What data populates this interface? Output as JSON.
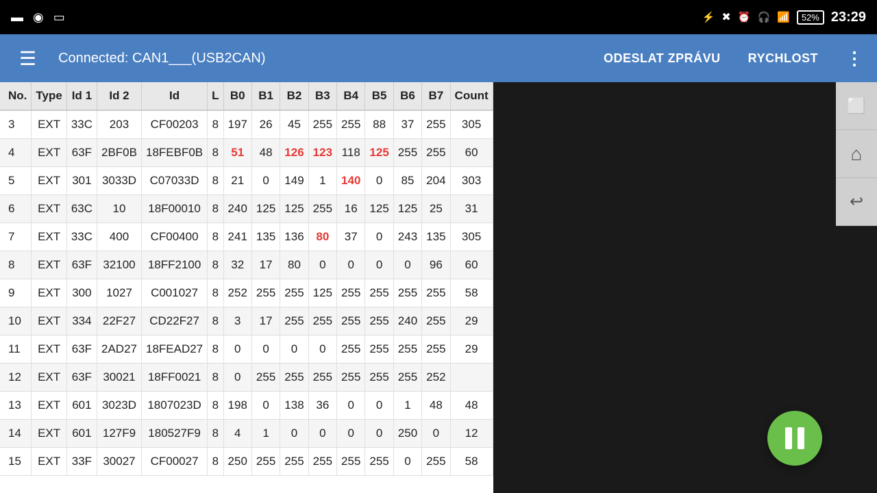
{
  "statusBar": {
    "time": "23:29",
    "battery": "52%",
    "icons": [
      "bluetooth",
      "muted",
      "alarm",
      "headset",
      "signal"
    ]
  },
  "appBar": {
    "title": "Connected: CAN1___(USB2CAN)",
    "action1": "ODESLAT ZPRÁVU",
    "action2": "RYCHLOST",
    "menuIcon": "⋮"
  },
  "table": {
    "headers": [
      "No.",
      "Type",
      "Id 1",
      "Id 2",
      "Id",
      "L",
      "B0",
      "B1",
      "B2",
      "B3",
      "B4",
      "B5",
      "B6",
      "B7",
      "Count"
    ],
    "rows": [
      {
        "no": "3",
        "type": "EXT",
        "id1": "33C",
        "id2": "203",
        "id": "CF00203",
        "l": "8",
        "b0": "197",
        "b1": "26",
        "b2": "45",
        "b3": "255",
        "b4": "255",
        "b5": "88",
        "b6": "37",
        "b7": "255",
        "count": "305",
        "highlights": []
      },
      {
        "no": "4",
        "type": "EXT",
        "id1": "63F",
        "id2": "2BF0B",
        "id": "18FEBF0B",
        "l": "8",
        "b0": "51",
        "b1": "48",
        "b2": "126",
        "b3": "123",
        "b4": "118",
        "b5": "125",
        "b6": "255",
        "b7": "255",
        "count": "60",
        "highlights": [
          "b0",
          "b2",
          "b3",
          "b5"
        ]
      },
      {
        "no": "5",
        "type": "EXT",
        "id1": "301",
        "id2": "3033D",
        "id": "C07033D",
        "l": "8",
        "b0": "21",
        "b1": "0",
        "b2": "149",
        "b3": "1",
        "b4": "140",
        "b5": "0",
        "b6": "85",
        "b7": "204",
        "count": "303",
        "highlights": [
          "b4"
        ]
      },
      {
        "no": "6",
        "type": "EXT",
        "id1": "63C",
        "id2": "10",
        "id": "18F00010",
        "l": "8",
        "b0": "240",
        "b1": "125",
        "b2": "125",
        "b3": "255",
        "b4": "16",
        "b5": "125",
        "b6": "125",
        "b7": "25",
        "count": "31",
        "highlights": []
      },
      {
        "no": "7",
        "type": "EXT",
        "id1": "33C",
        "id2": "400",
        "id": "CF00400",
        "l": "8",
        "b0": "241",
        "b1": "135",
        "b2": "136",
        "b3": "80",
        "b4": "37",
        "b5": "0",
        "b6": "243",
        "b7": "135",
        "count": "305",
        "highlights": [
          "b3"
        ]
      },
      {
        "no": "8",
        "type": "EXT",
        "id1": "63F",
        "id2": "32100",
        "id": "18FF2100",
        "l": "8",
        "b0": "32",
        "b1": "17",
        "b2": "80",
        "b3": "0",
        "b4": "0",
        "b5": "0",
        "b6": "0",
        "b7": "96",
        "count": "60",
        "highlights": []
      },
      {
        "no": "9",
        "type": "EXT",
        "id1": "300",
        "id2": "1027",
        "id": "C001027",
        "l": "8",
        "b0": "252",
        "b1": "255",
        "b2": "255",
        "b3": "125",
        "b4": "255",
        "b5": "255",
        "b6": "255",
        "b7": "255",
        "count": "58",
        "highlights": []
      },
      {
        "no": "10",
        "type": "EXT",
        "id1": "334",
        "id2": "22F27",
        "id": "CD22F27",
        "l": "8",
        "b0": "3",
        "b1": "17",
        "b2": "255",
        "b3": "255",
        "b4": "255",
        "b5": "255",
        "b6": "240",
        "b7": "255",
        "count": "29",
        "highlights": []
      },
      {
        "no": "11",
        "type": "EXT",
        "id1": "63F",
        "id2": "2AD27",
        "id": "18FEAD27",
        "l": "8",
        "b0": "0",
        "b1": "0",
        "b2": "0",
        "b3": "0",
        "b4": "255",
        "b5": "255",
        "b6": "255",
        "b7": "255",
        "count": "29",
        "highlights": []
      },
      {
        "no": "12",
        "type": "EXT",
        "id1": "63F",
        "id2": "30021",
        "id": "18FF0021",
        "l": "8",
        "b0": "0",
        "b1": "255",
        "b2": "255",
        "b3": "255",
        "b4": "255",
        "b5": "255",
        "b6": "255",
        "b7": "252",
        "count": "",
        "highlights": []
      },
      {
        "no": "13",
        "type": "EXT",
        "id1": "601",
        "id2": "3023D",
        "id": "1807023D",
        "l": "8",
        "b0": "198",
        "b1": "0",
        "b2": "138",
        "b3": "36",
        "b4": "0",
        "b5": "0",
        "b6": "1",
        "b7": "48",
        "count": "48",
        "highlights": []
      },
      {
        "no": "14",
        "type": "EXT",
        "id1": "601",
        "id2": "127F9",
        "id": "180527F9",
        "l": "8",
        "b0": "4",
        "b1": "1",
        "b2": "0",
        "b3": "0",
        "b4": "0",
        "b5": "0",
        "b6": "250",
        "b7": "0",
        "count": "12",
        "highlights": []
      },
      {
        "no": "15",
        "type": "EXT",
        "id1": "33F",
        "id2": "30027",
        "id": "CF00027",
        "l": "8",
        "b0": "250",
        "b1": "255",
        "b2": "255",
        "b3": "255",
        "b4": "255",
        "b5": "255",
        "b6": "0",
        "b7": "255",
        "count": "58",
        "highlights": []
      }
    ]
  },
  "rightPanel": {
    "btn1": "screen",
    "btn2": "home",
    "btn3": "back"
  },
  "pauseButton": {
    "label": "pause"
  }
}
